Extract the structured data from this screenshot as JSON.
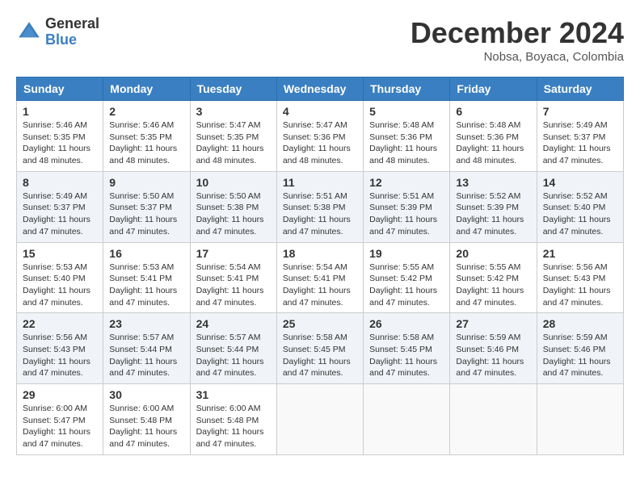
{
  "header": {
    "logo_general": "General",
    "logo_blue": "Blue",
    "month_title": "December 2024",
    "location": "Nobsa, Boyaca, Colombia"
  },
  "weekdays": [
    "Sunday",
    "Monday",
    "Tuesday",
    "Wednesday",
    "Thursday",
    "Friday",
    "Saturday"
  ],
  "weeks": [
    [
      {
        "day": "1",
        "sunrise": "5:46 AM",
        "sunset": "5:35 PM",
        "daylight": "11 hours and 48 minutes."
      },
      {
        "day": "2",
        "sunrise": "5:46 AM",
        "sunset": "5:35 PM",
        "daylight": "11 hours and 48 minutes."
      },
      {
        "day": "3",
        "sunrise": "5:47 AM",
        "sunset": "5:35 PM",
        "daylight": "11 hours and 48 minutes."
      },
      {
        "day": "4",
        "sunrise": "5:47 AM",
        "sunset": "5:36 PM",
        "daylight": "11 hours and 48 minutes."
      },
      {
        "day": "5",
        "sunrise": "5:48 AM",
        "sunset": "5:36 PM",
        "daylight": "11 hours and 48 minutes."
      },
      {
        "day": "6",
        "sunrise": "5:48 AM",
        "sunset": "5:36 PM",
        "daylight": "11 hours and 48 minutes."
      },
      {
        "day": "7",
        "sunrise": "5:49 AM",
        "sunset": "5:37 PM",
        "daylight": "11 hours and 47 minutes."
      }
    ],
    [
      {
        "day": "8",
        "sunrise": "5:49 AM",
        "sunset": "5:37 PM",
        "daylight": "11 hours and 47 minutes."
      },
      {
        "day": "9",
        "sunrise": "5:50 AM",
        "sunset": "5:37 PM",
        "daylight": "11 hours and 47 minutes."
      },
      {
        "day": "10",
        "sunrise": "5:50 AM",
        "sunset": "5:38 PM",
        "daylight": "11 hours and 47 minutes."
      },
      {
        "day": "11",
        "sunrise": "5:51 AM",
        "sunset": "5:38 PM",
        "daylight": "11 hours and 47 minutes."
      },
      {
        "day": "12",
        "sunrise": "5:51 AM",
        "sunset": "5:39 PM",
        "daylight": "11 hours and 47 minutes."
      },
      {
        "day": "13",
        "sunrise": "5:52 AM",
        "sunset": "5:39 PM",
        "daylight": "11 hours and 47 minutes."
      },
      {
        "day": "14",
        "sunrise": "5:52 AM",
        "sunset": "5:40 PM",
        "daylight": "11 hours and 47 minutes."
      }
    ],
    [
      {
        "day": "15",
        "sunrise": "5:53 AM",
        "sunset": "5:40 PM",
        "daylight": "11 hours and 47 minutes."
      },
      {
        "day": "16",
        "sunrise": "5:53 AM",
        "sunset": "5:41 PM",
        "daylight": "11 hours and 47 minutes."
      },
      {
        "day": "17",
        "sunrise": "5:54 AM",
        "sunset": "5:41 PM",
        "daylight": "11 hours and 47 minutes."
      },
      {
        "day": "18",
        "sunrise": "5:54 AM",
        "sunset": "5:41 PM",
        "daylight": "11 hours and 47 minutes."
      },
      {
        "day": "19",
        "sunrise": "5:55 AM",
        "sunset": "5:42 PM",
        "daylight": "11 hours and 47 minutes."
      },
      {
        "day": "20",
        "sunrise": "5:55 AM",
        "sunset": "5:42 PM",
        "daylight": "11 hours and 47 minutes."
      },
      {
        "day": "21",
        "sunrise": "5:56 AM",
        "sunset": "5:43 PM",
        "daylight": "11 hours and 47 minutes."
      }
    ],
    [
      {
        "day": "22",
        "sunrise": "5:56 AM",
        "sunset": "5:43 PM",
        "daylight": "11 hours and 47 minutes."
      },
      {
        "day": "23",
        "sunrise": "5:57 AM",
        "sunset": "5:44 PM",
        "daylight": "11 hours and 47 minutes."
      },
      {
        "day": "24",
        "sunrise": "5:57 AM",
        "sunset": "5:44 PM",
        "daylight": "11 hours and 47 minutes."
      },
      {
        "day": "25",
        "sunrise": "5:58 AM",
        "sunset": "5:45 PM",
        "daylight": "11 hours and 47 minutes."
      },
      {
        "day": "26",
        "sunrise": "5:58 AM",
        "sunset": "5:45 PM",
        "daylight": "11 hours and 47 minutes."
      },
      {
        "day": "27",
        "sunrise": "5:59 AM",
        "sunset": "5:46 PM",
        "daylight": "11 hours and 47 minutes."
      },
      {
        "day": "28",
        "sunrise": "5:59 AM",
        "sunset": "5:46 PM",
        "daylight": "11 hours and 47 minutes."
      }
    ],
    [
      {
        "day": "29",
        "sunrise": "6:00 AM",
        "sunset": "5:47 PM",
        "daylight": "11 hours and 47 minutes."
      },
      {
        "day": "30",
        "sunrise": "6:00 AM",
        "sunset": "5:48 PM",
        "daylight": "11 hours and 47 minutes."
      },
      {
        "day": "31",
        "sunrise": "6:00 AM",
        "sunset": "5:48 PM",
        "daylight": "11 hours and 47 minutes."
      },
      null,
      null,
      null,
      null
    ]
  ]
}
